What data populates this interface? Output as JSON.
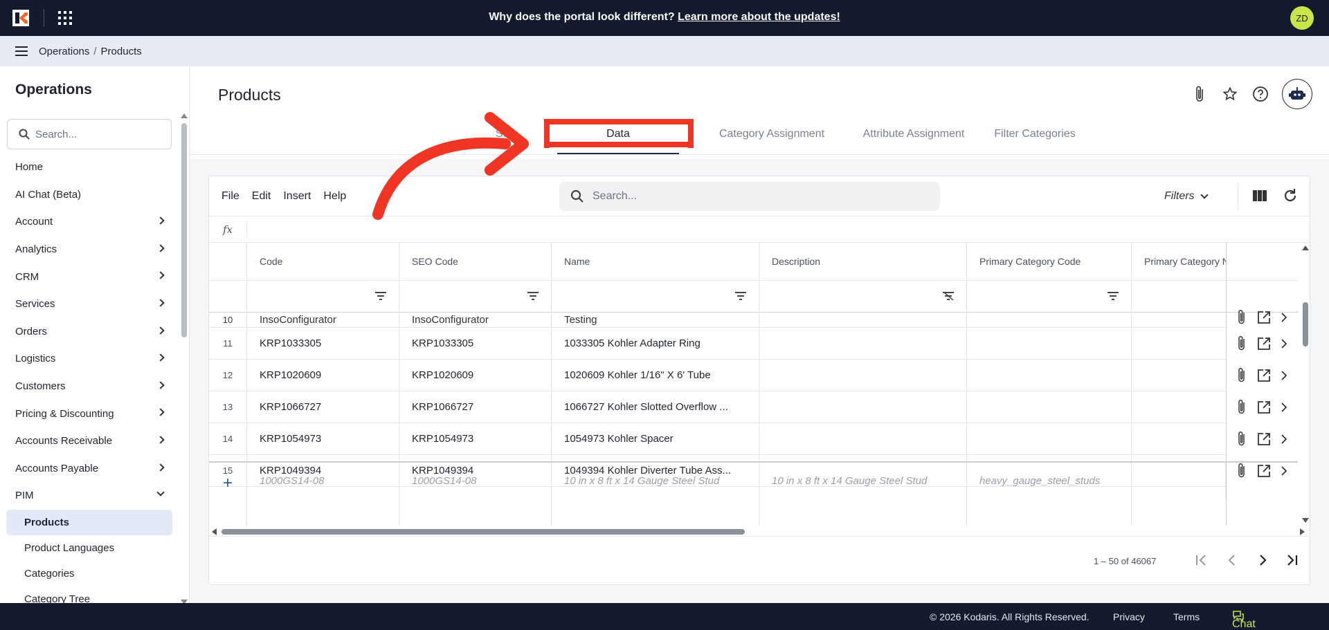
{
  "topbar": {
    "banner_text": "Why does the portal look different?",
    "banner_link": "Learn more about the updates!",
    "avatar_initials": "ZD"
  },
  "breadcrumb": [
    "Operations",
    "Products"
  ],
  "sidebar": {
    "title": "Operations",
    "search_placeholder": "Search...",
    "items": [
      {
        "label": "Home",
        "expandable": false
      },
      {
        "label": "AI Chat (Beta)",
        "expandable": false
      },
      {
        "label": "Account",
        "expandable": true
      },
      {
        "label": "Analytics",
        "expandable": true
      },
      {
        "label": "CRM",
        "expandable": true
      },
      {
        "label": "Services",
        "expandable": true
      },
      {
        "label": "Orders",
        "expandable": true
      },
      {
        "label": "Logistics",
        "expandable": true
      },
      {
        "label": "Customers",
        "expandable": true
      },
      {
        "label": "Pricing & Discounting",
        "expandable": true
      },
      {
        "label": "Accounts Receivable",
        "expandable": true
      },
      {
        "label": "Accounts Payable",
        "expandable": true
      },
      {
        "label": "PIM",
        "expandable": true,
        "expanded": true
      }
    ],
    "pim_children": [
      "Products",
      "Product Languages",
      "Categories",
      "Category Tree"
    ],
    "active_child": "Products"
  },
  "page": {
    "title": "Products",
    "tabs": [
      "Sea",
      "Data",
      "Category Assignment",
      "Attribute Assignment",
      "Filter Categories"
    ],
    "active_tab": "Data"
  },
  "grid": {
    "menus": [
      "File",
      "Edit",
      "Insert",
      "Help"
    ],
    "search_placeholder": "Search...",
    "filters_label": "Filters",
    "fx_label": "fx",
    "columns": [
      "Code",
      "SEO Code",
      "Name",
      "Description",
      "Primary Category Code",
      "Primary Category N"
    ],
    "partial_row": {
      "num": "10",
      "code": "InsoConfigurator",
      "seo": "InsoConfigurator",
      "name": "Testing"
    },
    "rows": [
      {
        "num": "11",
        "code": "KRP1033305",
        "seo": "KRP1033305",
        "name": "1033305 Kohler Adapter Ring"
      },
      {
        "num": "12",
        "code": "KRP1020609",
        "seo": "KRP1020609",
        "name": "1020609 Kohler 1/16\" X 6' Tube"
      },
      {
        "num": "13",
        "code": "KRP1066727",
        "seo": "KRP1066727",
        "name": "1066727 Kohler Slotted Overflow ..."
      },
      {
        "num": "14",
        "code": "KRP1054973",
        "seo": "KRP1054973",
        "name": "1054973 Kohler Spacer"
      },
      {
        "num": "15",
        "code": "KRP1049394",
        "seo": "KRP1049394",
        "name": "1049394 Kohler Diverter Tube Ass..."
      }
    ],
    "new_row_placeholders": {
      "code": "1000GS14-08",
      "seo": "1000GS14-08",
      "name": "10 in x 8 ft x 14 Gauge Steel Stud",
      "description": "10 in x 8 ft x 14 Gauge Steel Stud",
      "primary_category": "heavy_gauge_steel_studs"
    },
    "pagination": "1 – 50 of 46067"
  },
  "footer": {
    "copyright": "© 2026 Kodaris. All Rights Reserved.",
    "privacy": "Privacy",
    "terms": "Terms",
    "chat": "Chat with us"
  },
  "colors": {
    "topbar": "#141b2e",
    "accent_avatar": "#c8e64a",
    "highlight": "#f03524"
  }
}
